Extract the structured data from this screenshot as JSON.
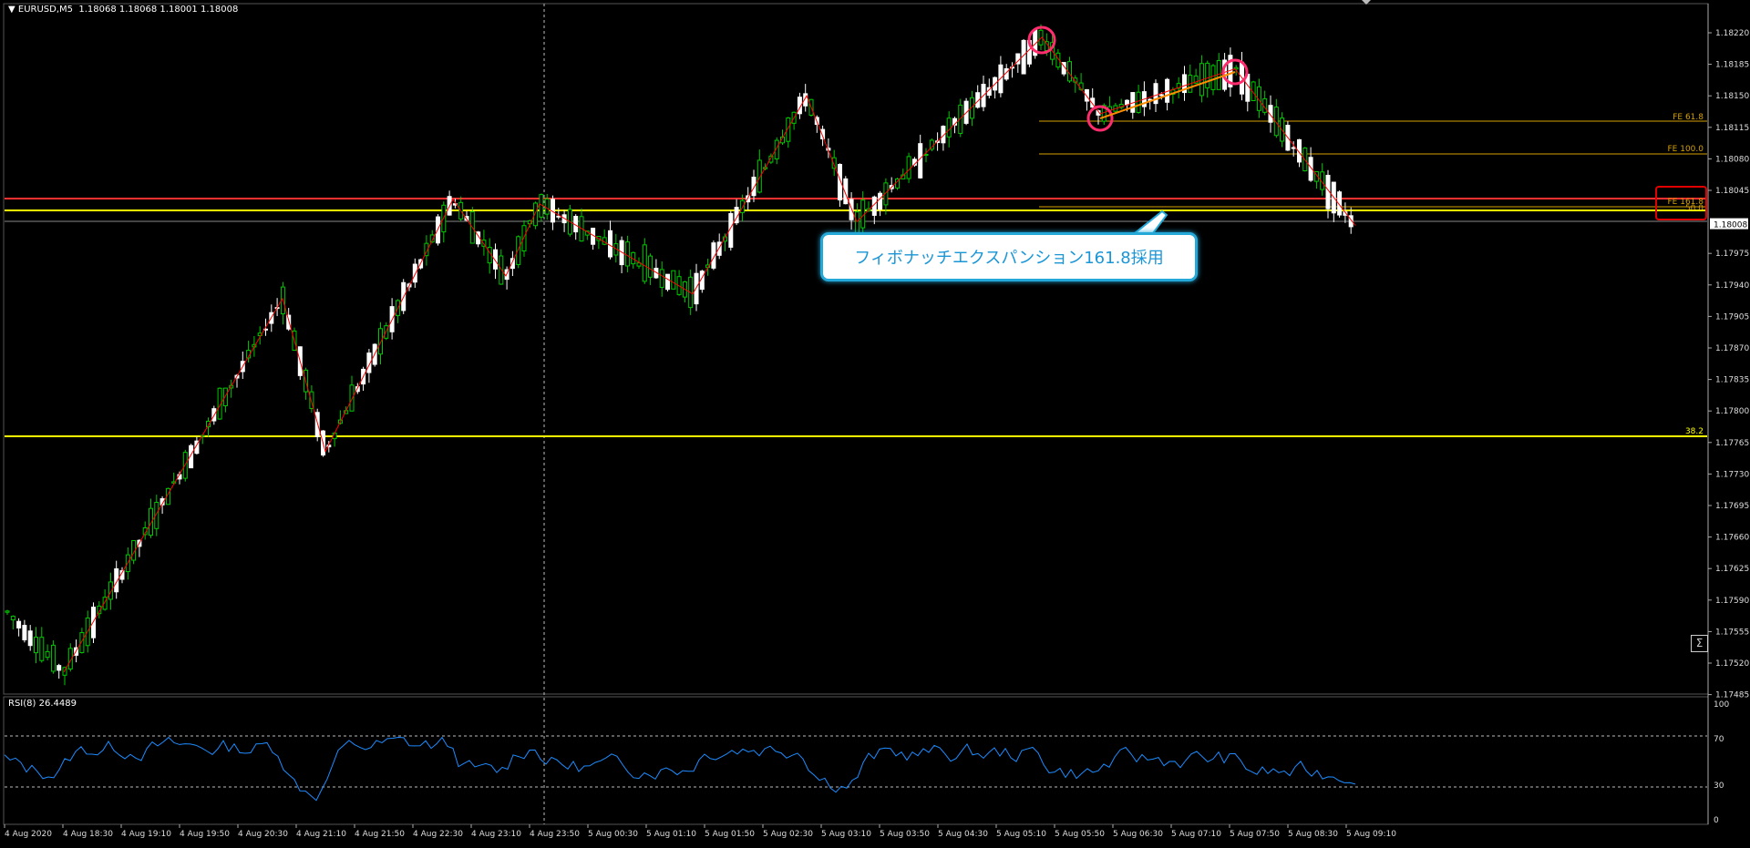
{
  "header": {
    "symbol": "EURUSD,M5",
    "ohlc": "1.18068 1.18068 1.18001 1.18008"
  },
  "rsi": {
    "label": "RSI(8) 26.4489"
  },
  "callout": {
    "text": "フィボナッチエクスパンション161.8採用"
  },
  "sigma_label": "Σ",
  "colors": {
    "background": "#000000",
    "bull_candle": "#00c800",
    "bear_candle": "#ffffff",
    "zigzag": "#ff0000",
    "fib_fe_lines": "#d4a000",
    "support_yellow": "#ffff00",
    "resistance_red": "#ff3030",
    "rsi_line": "#1e8cff",
    "highlight_circle": "#ff2d6e",
    "callout_border": "#24a8d8"
  },
  "chart_data": {
    "type": "candlestick",
    "symbol": "EURUSD",
    "timeframe": "M5",
    "price_axis_ticks": [
      "1.18220",
      "1.18185",
      "1.18150",
      "1.18115",
      "1.18080",
      "1.18045",
      "1.18008",
      "1.17975",
      "1.17940",
      "1.17905",
      "1.17870",
      "1.17835",
      "1.17800",
      "1.17765",
      "1.17730",
      "1.17695",
      "1.17660",
      "1.17625",
      "1.17590",
      "1.17555",
      "1.17520",
      "1.17485"
    ],
    "current_price": 1.18008,
    "time_axis_ticks": [
      "4 Aug 2020",
      "4 Aug 18:30",
      "4 Aug 19:10",
      "4 Aug 19:50",
      "4 Aug 20:30",
      "4 Aug 21:10",
      "4 Aug 21:50",
      "4 Aug 22:30",
      "4 Aug 23:10",
      "4 Aug 23:50",
      "5 Aug 00:30",
      "5 Aug 01:10",
      "5 Aug 01:50",
      "5 Aug 02:30",
      "5 Aug 03:10",
      "5 Aug 03:50",
      "5 Aug 04:30",
      "5 Aug 05:10",
      "5 Aug 05:50",
      "5 Aug 06:30",
      "5 Aug 07:10",
      "5 Aug 07:50",
      "5 Aug 08:30",
      "5 Aug 09:10"
    ],
    "fib_levels": [
      {
        "label": "FE 61.8",
        "price": 1.18121
      },
      {
        "label": "FE 100.0",
        "price": 1.18085
      },
      {
        "label": "FE 161.8",
        "price": 1.18027
      },
      {
        "label": "50.0",
        "price": 1.18022
      },
      {
        "label": "38.2",
        "price": 1.17768
      }
    ],
    "horizontal_lines": [
      {
        "name": "red-resistance",
        "price": 1.18033
      },
      {
        "name": "yellow-level",
        "price": 1.18022
      },
      {
        "name": "yellow-support",
        "price": 1.17768
      }
    ],
    "zigzag_prices": [
      1.1751,
      1.17925,
      1.17755,
      1.18035,
      1.1795,
      1.1803,
      1.1793,
      1.1815,
      1.1801,
      1.18215,
      1.1813,
      1.1818,
      1.18006
    ],
    "rsi_axis_ticks": [
      "100",
      "70",
      "30",
      "0"
    ],
    "rsi_levels": [
      70,
      30
    ],
    "rsi_current": 26.4489
  }
}
